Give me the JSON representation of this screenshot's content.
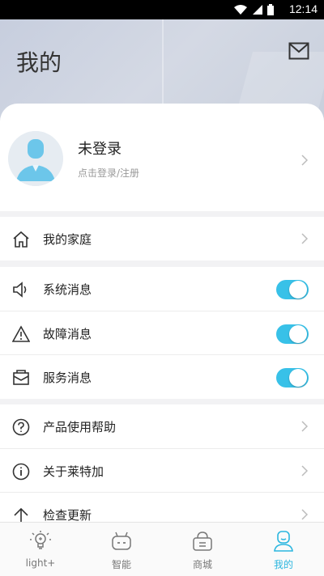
{
  "status_bar": {
    "time": "12:14"
  },
  "header": {
    "title": "我的"
  },
  "profile": {
    "name": "未登录",
    "subtitle": "点击登录/注册"
  },
  "menu": {
    "family": "我的家庭",
    "system_msg": "系统消息",
    "fault_msg": "故障消息",
    "service_msg": "服务消息",
    "help": "产品使用帮助",
    "about": "关于莱特加",
    "update": "检查更新"
  },
  "toggles": {
    "system_msg": true,
    "fault_msg": true,
    "service_msg": true
  },
  "tabs": [
    {
      "label": "light+",
      "icon": "bulb-icon"
    },
    {
      "label": "智能",
      "icon": "robot-icon"
    },
    {
      "label": "商城",
      "icon": "shop-basket-icon"
    },
    {
      "label": "我的",
      "icon": "user-profile-icon",
      "active": true
    }
  ],
  "colors": {
    "accent": "#38c1e8",
    "active_tab": "#2bb6df"
  }
}
